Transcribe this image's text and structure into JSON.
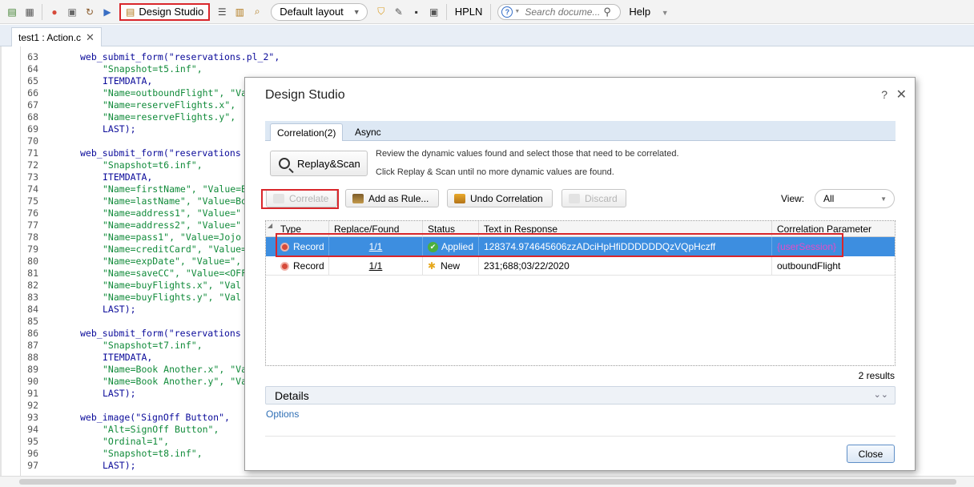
{
  "toolbar": {
    "design_studio_label": "Design Studio",
    "layout_value": "Default layout",
    "hpln_label": "HPLN",
    "search_placeholder": "Search docume...",
    "help_label": "Help"
  },
  "editor_tab": {
    "label": "test1 : Action.c"
  },
  "code_lines": [
    {
      "n": "63",
      "i": 0,
      "t": "web_submit_form(\"reservations.pl_2\","
    },
    {
      "n": "64",
      "i": 1,
      "t": "\"Snapshot=t5.inf\","
    },
    {
      "n": "65",
      "i": 1,
      "t": "ITEMDATA,"
    },
    {
      "n": "66",
      "i": 1,
      "t": "\"Name=outboundFlight\", \"Va"
    },
    {
      "n": "67",
      "i": 1,
      "t": "\"Name=reserveFlights.x\","
    },
    {
      "n": "68",
      "i": 1,
      "t": "\"Name=reserveFlights.y\","
    },
    {
      "n": "69",
      "i": 1,
      "t": "LAST);"
    },
    {
      "n": "70",
      "i": 0,
      "t": ""
    },
    {
      "n": "71",
      "i": 0,
      "t": "web_submit_form(\"reservations"
    },
    {
      "n": "72",
      "i": 1,
      "t": "\"Snapshot=t6.inf\","
    },
    {
      "n": "73",
      "i": 1,
      "t": "ITEMDATA,"
    },
    {
      "n": "74",
      "i": 1,
      "t": "\"Name=firstName\", \"Value=B"
    },
    {
      "n": "75",
      "i": 1,
      "t": "\"Name=lastName\", \"Value=Bo"
    },
    {
      "n": "76",
      "i": 1,
      "t": "\"Name=address1\", \"Value=\""
    },
    {
      "n": "77",
      "i": 1,
      "t": "\"Name=address2\", \"Value=\""
    },
    {
      "n": "78",
      "i": 1,
      "t": "\"Name=pass1\", \"Value=Jojo"
    },
    {
      "n": "79",
      "i": 1,
      "t": "\"Name=creditCard\", \"Value="
    },
    {
      "n": "80",
      "i": 1,
      "t": "\"Name=expDate\", \"Value=\","
    },
    {
      "n": "81",
      "i": 1,
      "t": "\"Name=saveCC\", \"Value=<OFF"
    },
    {
      "n": "82",
      "i": 1,
      "t": "\"Name=buyFlights.x\", \"Val"
    },
    {
      "n": "83",
      "i": 1,
      "t": "\"Name=buyFlights.y\", \"Val"
    },
    {
      "n": "84",
      "i": 1,
      "t": "LAST);"
    },
    {
      "n": "85",
      "i": 0,
      "t": ""
    },
    {
      "n": "86",
      "i": 0,
      "t": "web_submit_form(\"reservations"
    },
    {
      "n": "87",
      "i": 1,
      "t": "\"Snapshot=t7.inf\","
    },
    {
      "n": "88",
      "i": 1,
      "t": "ITEMDATA,"
    },
    {
      "n": "89",
      "i": 1,
      "t": "\"Name=Book Another.x\", \"Va"
    },
    {
      "n": "90",
      "i": 1,
      "t": "\"Name=Book Another.y\", \"Va"
    },
    {
      "n": "91",
      "i": 1,
      "t": "LAST);"
    },
    {
      "n": "92",
      "i": 0,
      "t": ""
    },
    {
      "n": "93",
      "i": 0,
      "t": "web_image(\"SignOff Button\","
    },
    {
      "n": "94",
      "i": 1,
      "t": "\"Alt=SignOff Button\","
    },
    {
      "n": "95",
      "i": 1,
      "t": "\"Ordinal=1\","
    },
    {
      "n": "96",
      "i": 1,
      "t": "\"Snapshot=t8.inf\","
    },
    {
      "n": "97",
      "i": 1,
      "t": "LAST);"
    }
  ],
  "dialog": {
    "title": "Design Studio",
    "help": "?",
    "close_x": "✕",
    "tabs": [
      "Correlation(2)",
      "Async"
    ],
    "replay_label": "Replay&Scan",
    "hint1": "Review the dynamic values found and select those that need to be correlated.",
    "hint2": "Click Replay & Scan until no more dynamic values are found.",
    "actions": {
      "correlate": "Correlate",
      "add_rule": "Add as Rule...",
      "undo": "Undo Correlation",
      "discard": "Discard"
    },
    "view_label": "View:",
    "view_value": "All",
    "columns": [
      "Type",
      "Replace/Found",
      "Status",
      "Text in Response",
      "Correlation Parameter"
    ],
    "rows": [
      {
        "type": "Record",
        "replace": "1/1",
        "status": "Applied",
        "text": "128374.974645606zzADciHpHfiDDDDDDQzVQpHczff",
        "param": "{userSession}"
      },
      {
        "type": "Record",
        "replace": "1/1",
        "status": "New",
        "text": "231;688;03/22/2020",
        "param": "outboundFlight"
      }
    ],
    "results": "2 results",
    "details": "Details",
    "options": "Options",
    "close": "Close"
  },
  "colors": {
    "highlight_red": "#d9262b",
    "selection_blue": "#3d8ee0"
  }
}
